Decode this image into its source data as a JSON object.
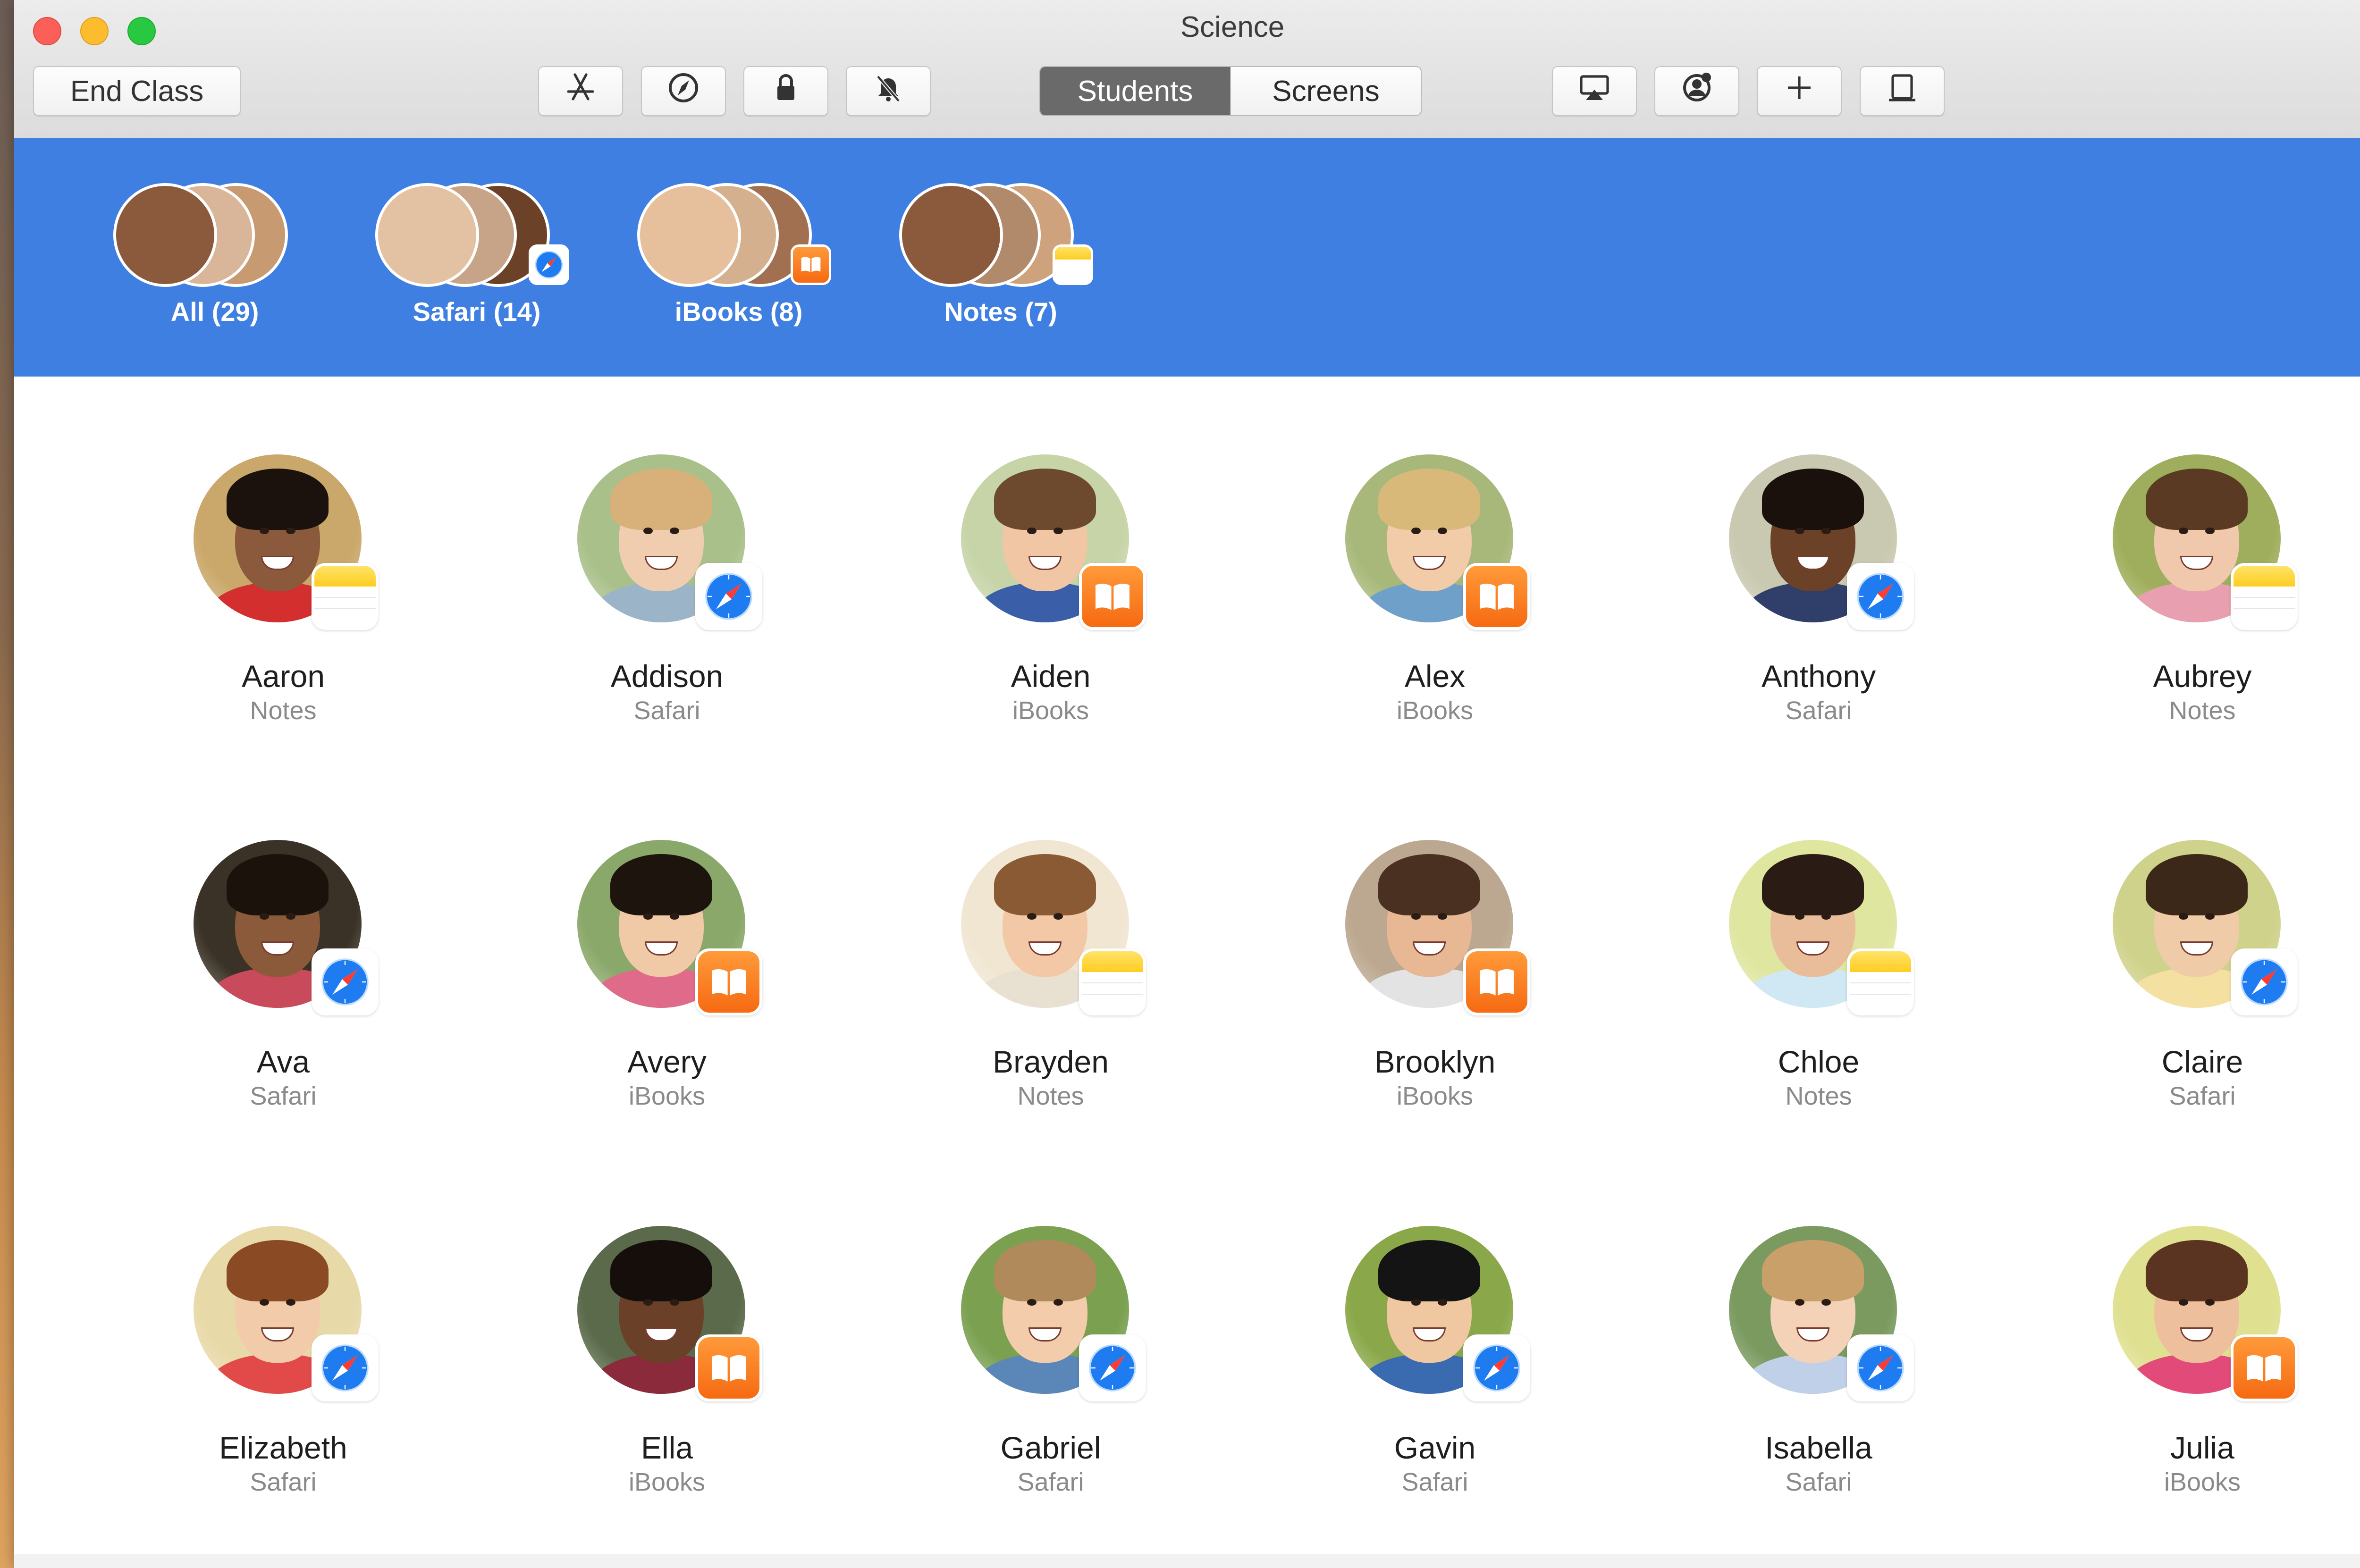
{
  "window": {
    "title": "Science"
  },
  "toolbar": {
    "end_class_label": "End Class",
    "left_icons": [
      "app-store-icon",
      "safari-compass-icon",
      "lock-icon",
      "mute-icon"
    ],
    "view_tabs": [
      {
        "label": "Students",
        "active": true
      },
      {
        "label": "Screens",
        "active": false
      }
    ],
    "right_icons": [
      "airplay-icon",
      "user-badge-icon",
      "add-icon",
      "device-icon"
    ]
  },
  "groups": [
    {
      "label": "All (29)",
      "badge": "",
      "selected": true
    },
    {
      "label": "Safari (14)",
      "badge": "safari",
      "selected": false
    },
    {
      "label": "iBooks (8)",
      "badge": "ibooks",
      "selected": false
    },
    {
      "label": "Notes (7)",
      "badge": "notes",
      "selected": false
    }
  ],
  "students": [
    {
      "name": "Aaron",
      "app": "Notes",
      "badge": "notes",
      "skin": "#8b5a3c",
      "hair": "#1b120d",
      "shirt": "#d32f2f",
      "bg": "#caa76a"
    },
    {
      "name": "Addison",
      "app": "Safari",
      "badge": "safari",
      "skin": "#f1cdb0",
      "hair": "#d8b07a",
      "shirt": "#9cb4c8",
      "bg": "#a9c08a"
    },
    {
      "name": "Aiden",
      "app": "iBooks",
      "badge": "ibooks",
      "skin": "#f0c6a4",
      "hair": "#6d4a2e",
      "shirt": "#3a5fa8",
      "bg": "#c7d4a8"
    },
    {
      "name": "Alex",
      "app": "iBooks",
      "badge": "ibooks",
      "skin": "#f2cba8",
      "hair": "#d9b97a",
      "shirt": "#6fa0c9",
      "bg": "#a8b87a"
    },
    {
      "name": "Anthony",
      "app": "Safari",
      "badge": "safari",
      "skin": "#6b4128",
      "hair": "#1a110c",
      "shirt": "#2f3f6a",
      "bg": "#c9c8b0"
    },
    {
      "name": "Aubrey",
      "app": "Notes",
      "badge": "notes",
      "skin": "#f0c9ad",
      "hair": "#5a3a22",
      "shirt": "#e8a0b0",
      "bg": "#9fae5c"
    },
    {
      "name": "Ava",
      "app": "Safari",
      "badge": "safari",
      "skin": "#8a5a3a",
      "hair": "#1c120c",
      "shirt": "#c94a5a",
      "bg": "#3a3226"
    },
    {
      "name": "Avery",
      "app": "iBooks",
      "badge": "ibooks",
      "skin": "#f0c9a6",
      "hair": "#1e140e",
      "shirt": "#e06a8a",
      "bg": "#8aa86a"
    },
    {
      "name": "Brayden",
      "app": "Notes",
      "badge": "notes",
      "skin": "#f2c8a6",
      "hair": "#8a5a34",
      "shirt": "#e8e0d0",
      "bg": "#f1e6d2"
    },
    {
      "name": "Brooklyn",
      "app": "iBooks",
      "badge": "ibooks",
      "skin": "#e8b794",
      "hair": "#4a3020",
      "shirt": "#e3e3e3",
      "bg": "#bca890"
    },
    {
      "name": "Chloe",
      "app": "Notes",
      "badge": "notes",
      "skin": "#e9bd9a",
      "hair": "#2a1c14",
      "shirt": "#cfe8f4",
      "bg": "#dfe6a0"
    },
    {
      "name": "Claire",
      "app": "Safari",
      "badge": "safari",
      "skin": "#f0cba8",
      "hair": "#3c2818",
      "shirt": "#f4e0a0",
      "bg": "#cfd28a"
    },
    {
      "name": "Elizabeth",
      "app": "Safari",
      "badge": "safari",
      "skin": "#f2cbaa",
      "hair": "#8a4a24",
      "shirt": "#e24a4a",
      "bg": "#e8d9a8"
    },
    {
      "name": "Ella",
      "app": "iBooks",
      "badge": "ibooks",
      "skin": "#6a4028",
      "hair": "#160e0a",
      "shirt": "#8a2a3a",
      "bg": "#5a6a4a"
    },
    {
      "name": "Gabriel",
      "app": "Safari",
      "badge": "safari",
      "skin": "#f3cdab",
      "hair": "#b08a5a",
      "shirt": "#5a86b8",
      "bg": "#7aa050"
    },
    {
      "name": "Gavin",
      "app": "Safari",
      "badge": "safari",
      "skin": "#efc7a0",
      "hair": "#141414",
      "shirt": "#3a6ab0",
      "bg": "#8aa84a"
    },
    {
      "name": "Isabella",
      "app": "Safari",
      "badge": "safari",
      "skin": "#f3d2b8",
      "hair": "#caa06a",
      "shirt": "#c0d0e8",
      "bg": "#7a9a60"
    },
    {
      "name": "Julia",
      "app": "iBooks",
      "badge": "ibooks",
      "skin": "#eebf9c",
      "hair": "#5a3420",
      "shirt": "#e24a7a",
      "bg": "#dfe090"
    }
  ],
  "colors": {
    "accent_blue": "#3f7fe2",
    "ibooks_orange": "#f66a12",
    "safari_blue": "#1e7bf0",
    "notes_yellow": "#ffcd21"
  }
}
